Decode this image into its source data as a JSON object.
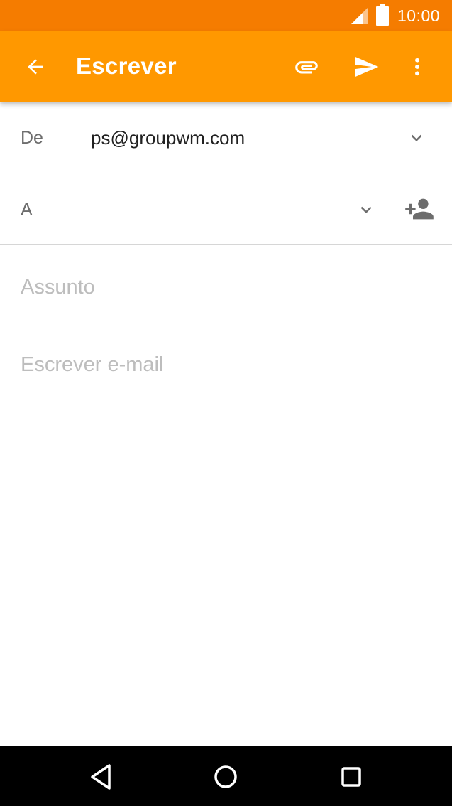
{
  "status_bar": {
    "time": "10:00",
    "icons": [
      "signal-icon",
      "battery-icon"
    ]
  },
  "app_bar": {
    "title": "Escrever",
    "color": "#ff9800",
    "actions": [
      "back-arrow-icon",
      "attach-icon",
      "send-icon",
      "more-vert-icon"
    ]
  },
  "compose": {
    "from_label": "De",
    "from_value": "ps@groupwm.com",
    "to_label": "A",
    "subject_placeholder": "Assunto",
    "body_placeholder": "Escrever e-mail"
  },
  "nav_bar": {
    "icons": [
      "nav-back-icon",
      "nav-home-icon",
      "nav-recents-icon"
    ]
  }
}
